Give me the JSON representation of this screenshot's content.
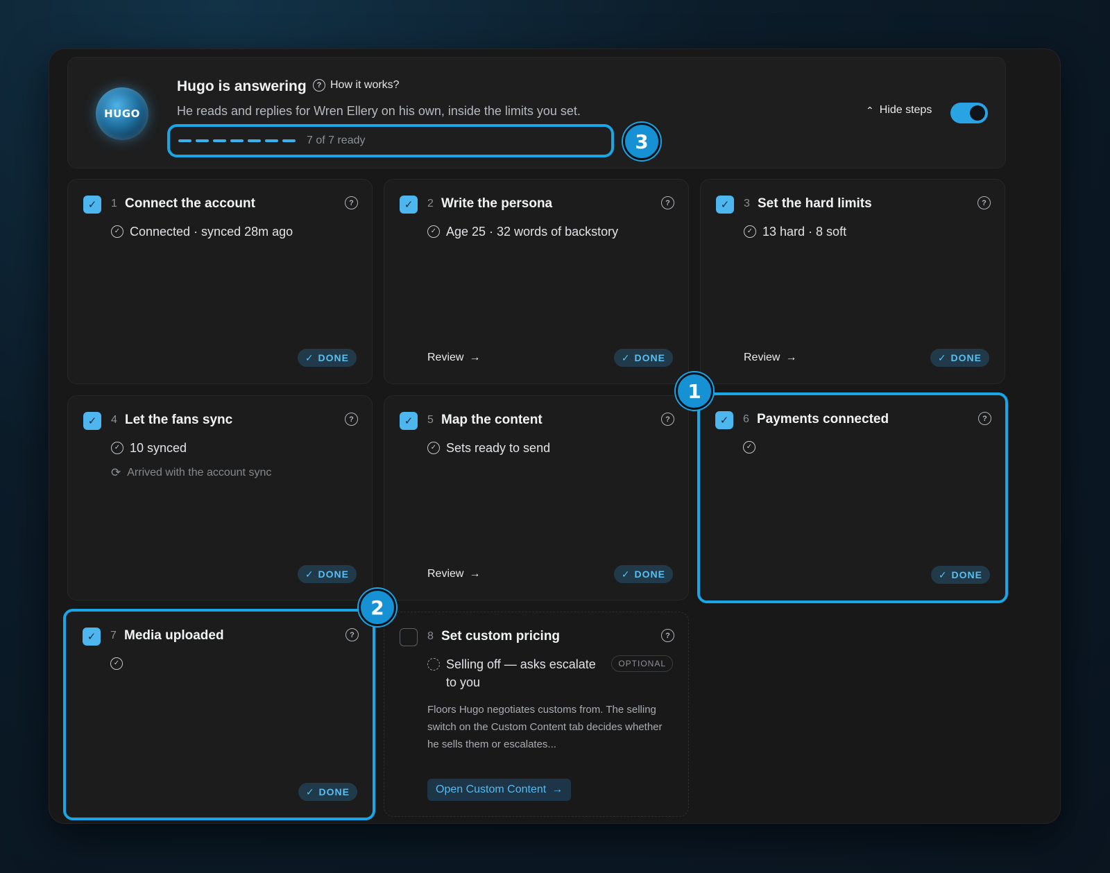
{
  "header": {
    "logo_text": "HUGO",
    "title": "Hugo is answering",
    "how_label": "How it works?",
    "subtitle": "He reads and replies for Wren Ellery on his own, inside the limits you set.",
    "progress_text": "7 of 7 ready",
    "progress": {
      "ready": 7,
      "total": 7
    },
    "hide_steps_label": "Hide steps",
    "toggle_on": true
  },
  "callouts": [
    "1",
    "2",
    "3"
  ],
  "steps": [
    {
      "number": "1",
      "title": "Connect the account",
      "status": "Connected · synced 28m ago",
      "badge": "DONE",
      "checked": true
    },
    {
      "number": "2",
      "title": "Write the persona",
      "status": "Age 25 · 32 words of backstory",
      "link": "Review",
      "badge": "DONE",
      "checked": true
    },
    {
      "number": "3",
      "title": "Set the hard limits",
      "status": "13 hard · 8 soft",
      "link": "Review",
      "badge": "DONE",
      "checked": true
    },
    {
      "number": "4",
      "title": "Let the fans sync",
      "status": "10 synced",
      "note": "Arrived with the account sync",
      "badge": "DONE",
      "checked": true
    },
    {
      "number": "5",
      "title": "Map the content",
      "status": "Sets ready to send",
      "link": "Review",
      "badge": "DONE",
      "checked": true
    },
    {
      "number": "6",
      "title": "Payments connected",
      "status": "",
      "badge": "DONE",
      "checked": true
    },
    {
      "number": "7",
      "title": "Media uploaded",
      "status": "",
      "badge": "DONE",
      "checked": true
    },
    {
      "number": "8",
      "title": "Set custom pricing",
      "status_line1": "Selling off — asks escalate",
      "status_line2": "to you",
      "optional": "OPTIONAL",
      "description": "Floors Hugo negotiates customs from. The selling switch on the Custom Content tab decides whether he sells them or escalates...",
      "button": "Open Custom Content",
      "checked": false
    }
  ],
  "colors": {
    "accent": "#1aa6e6",
    "badge_text": "#5bbef1",
    "background": "#181818"
  }
}
